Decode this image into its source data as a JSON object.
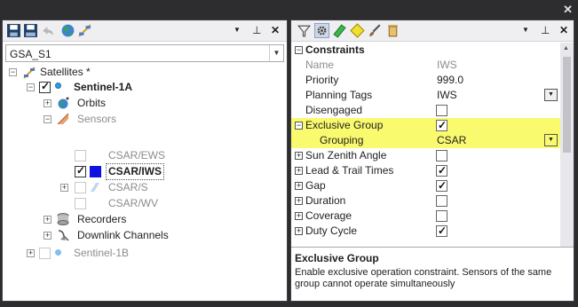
{
  "left": {
    "combo_value": "GSA_S1",
    "tree": [
      {
        "label": "Satellites *"
      },
      {
        "label": "Sentinel-1A"
      },
      {
        "label": "Orbits"
      },
      {
        "label": "Sensors"
      },
      {
        "label": "CSAR/EWS"
      },
      {
        "label": "CSAR/IWS"
      },
      {
        "label": "CSAR/S"
      },
      {
        "label": "CSAR/WV"
      },
      {
        "label": "Recorders"
      },
      {
        "label": "Downlink Channels"
      },
      {
        "label": "Sentinel-1B"
      }
    ]
  },
  "right": {
    "props": [
      {
        "name": "Constraints",
        "value": ""
      },
      {
        "name": "Name",
        "value": "IWS"
      },
      {
        "name": "Priority",
        "value": "999.0"
      },
      {
        "name": "Planning Tags",
        "value": "IWS"
      },
      {
        "name": "Disengaged",
        "value": ""
      },
      {
        "name": "Exclusive Group",
        "value": ""
      },
      {
        "name": "Grouping",
        "value": "CSAR"
      },
      {
        "name": "Sun Zenith Angle",
        "value": ""
      },
      {
        "name": "Lead & Trail Times",
        "value": ""
      },
      {
        "name": "Gap",
        "value": ""
      },
      {
        "name": "Duration",
        "value": ""
      },
      {
        "name": "Coverage",
        "value": ""
      },
      {
        "name": "Duty Cycle",
        "value": ""
      }
    ],
    "desc_title": "Exclusive Group",
    "desc_text": "Enable exclusive operation constraint. Sensors of the same group cannot operate simultaneously"
  },
  "colors": {
    "highlight": "#fafa6e",
    "selected_square": "#1010e0"
  }
}
